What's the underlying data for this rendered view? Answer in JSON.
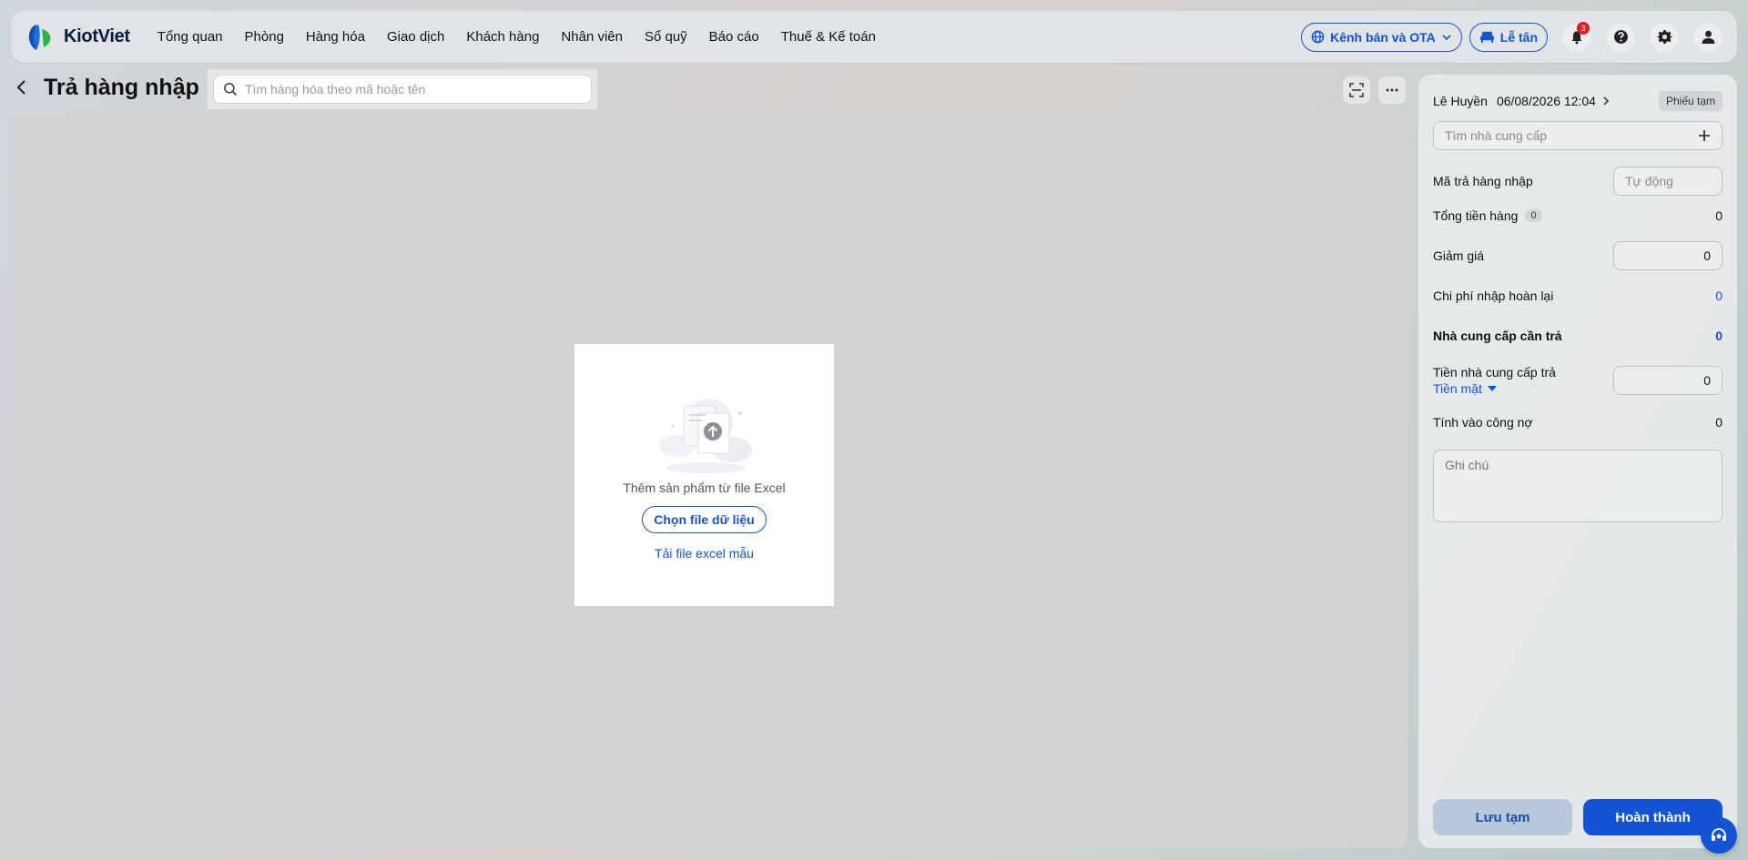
{
  "app": {
    "brand": "KiotViet"
  },
  "nav": {
    "items": [
      "Tổng quan",
      "Phòng",
      "Hàng hóa",
      "Giao dịch",
      "Khách hàng",
      "Nhân viên",
      "Sổ quỹ",
      "Báo cáo",
      "Thuế & Kế toán"
    ]
  },
  "header_right": {
    "channel_label": "Kênh bán và OTA",
    "reception_label": "Lễ tân",
    "notification_count": "3",
    "icons": [
      "globe-icon",
      "chevron-down-icon",
      "bed-icon",
      "bell-icon",
      "help-icon",
      "gear-icon",
      "user-icon"
    ]
  },
  "page": {
    "title": "Trả hàng nhập",
    "search_placeholder": "Tìm hàng hóa theo mã hoặc tên"
  },
  "upload": {
    "text": "Thêm sản phẩm từ file Excel",
    "choose_label": "Chọn file dữ liệu",
    "template_link": "Tải file excel mẫu"
  },
  "side": {
    "user": "Lê Huyền",
    "datetime": "06/08/2026 12:04",
    "status_tag": "Phiếu tạm",
    "supplier_placeholder": "Tìm nhà cung cấp",
    "return_code_label": "Mã trả hàng nhập",
    "return_code_placeholder": "Tự động",
    "total_label": "Tổng tiền hàng",
    "total_count": "0",
    "total_value": "0",
    "discount_label": "Giảm giá",
    "discount_value": "0",
    "refund_cost_label": "Chi phí nhập hoàn lại",
    "refund_cost_value": "0",
    "supplier_due_label": "Nhà cung cấp cần trả",
    "supplier_due_value": "0",
    "supplier_paid_label": "Tiền nhà cung cấp trả",
    "payment_method": "Tiền mặt",
    "supplier_paid_value": "0",
    "debt_label": "Tính vào công nợ",
    "debt_value": "0",
    "note_placeholder": "Ghi chú",
    "save_label": "Lưu tạm",
    "done_label": "Hoàn thành"
  },
  "colors": {
    "accent": "#1453d4",
    "badge": "#e02020"
  }
}
